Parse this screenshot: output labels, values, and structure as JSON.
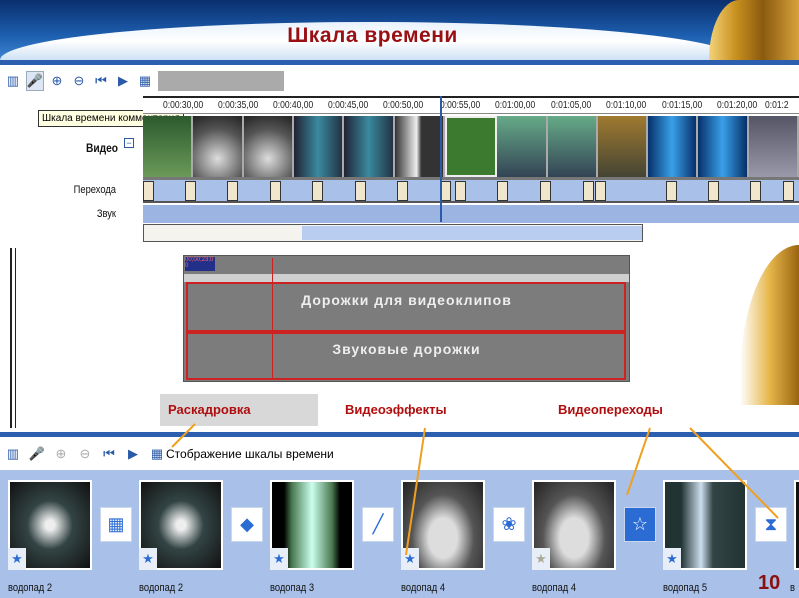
{
  "slide": {
    "title": "Шкала времени",
    "page_number": "10"
  },
  "timeline_view": {
    "tooltip": "Шкала времени комментария",
    "ruler": [
      "0:00:30,00",
      "0:00:35,00",
      "0:00:40,00",
      "0:00:45,00",
      "0:00:50,00",
      "0:00:55,00",
      "0:01:00,00",
      "0:01:05,00",
      "0:01:10,00",
      "0:01:15,00",
      "0:01:20,00",
      "0:01:2"
    ],
    "tracks": {
      "video": "Видео",
      "transitions": "Перехода",
      "audio": "Звук"
    },
    "collapse": "−"
  },
  "premiere": {
    "timecode": "00;00;23;00",
    "video_tracks": "Дорожки для видеоклипов",
    "audio_tracks": "Звуковые дорожки"
  },
  "callouts": {
    "storyboard": "Раскадровка",
    "effects": "Видеоэффекты",
    "transitions": "Видеопереходы"
  },
  "storyboard_view": {
    "toggle_label": "Стображение шкалы времени",
    "clips": [
      "водопад 2",
      "водопад 2",
      "водопад 3",
      "водопад 4",
      "водопад 4",
      "водопад 5",
      "в"
    ],
    "transition_icons": [
      "▦",
      "◆",
      "╱",
      "❀",
      "☆",
      "⧗"
    ]
  },
  "colors": {
    "title": "#9a0f12",
    "track": "#a9c0e8",
    "arrow": "#f0a020"
  }
}
